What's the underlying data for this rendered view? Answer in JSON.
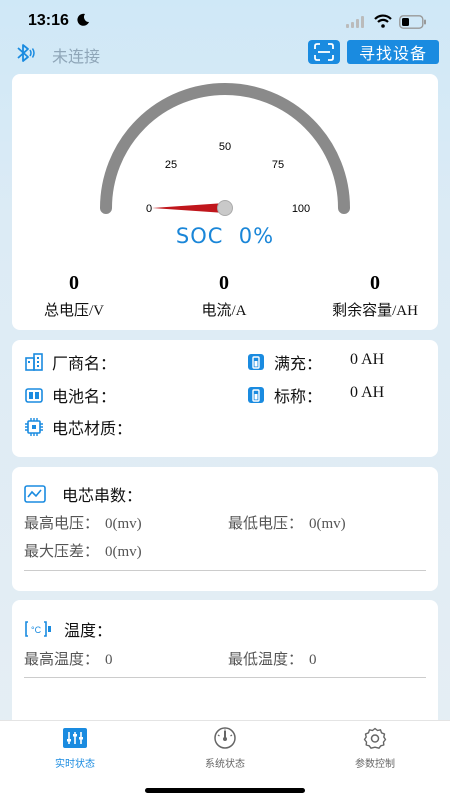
{
  "status_bar": {
    "time": "13:16"
  },
  "top_bar": {
    "connection_status": "未连接",
    "find_device_label": "寻找设备"
  },
  "gauge": {
    "ticks": [
      "0",
      "25",
      "50",
      "75",
      "100"
    ],
    "soc_label": "SOC",
    "soc_value": "0%",
    "needle_value": 0
  },
  "stats": [
    {
      "value": "0",
      "label": "总电压/V"
    },
    {
      "value": "0",
      "label": "电流/A"
    },
    {
      "value": "0",
      "label": "剩余容量/AH"
    }
  ],
  "battery_info": {
    "manufacturer_label": "厂商名：",
    "battery_name_label": "电池名：",
    "cell_material_label": "电芯材质：",
    "full_charge_label": "满充：",
    "full_charge_value": "0 AH",
    "nominal_label": "标称：",
    "nominal_value": "0 AH"
  },
  "cells": {
    "title": "电芯串数：",
    "max_voltage_label": "最高电压：",
    "max_voltage_value": "0(mv)",
    "min_voltage_label": "最低电压：",
    "min_voltage_value": "0(mv)",
    "max_diff_label": "最大压差：",
    "max_diff_value": "0(mv)"
  },
  "temperature": {
    "title": "温度：",
    "max_temp_label": "最高温度：",
    "max_temp_value": "0",
    "min_temp_label": "最低温度：",
    "min_temp_value": "0"
  },
  "tabs": [
    {
      "label": "实时状态",
      "icon": "sliders-icon",
      "active": true
    },
    {
      "label": "系统状态",
      "icon": "gauge-icon",
      "active": false
    },
    {
      "label": "参数控制",
      "icon": "gear-icon",
      "active": false
    }
  ],
  "colors": {
    "accent": "#1a8be0",
    "soc_text": "#1a86d8",
    "needle": "#c0161c",
    "gauge_arc": "#8a8a8a"
  }
}
